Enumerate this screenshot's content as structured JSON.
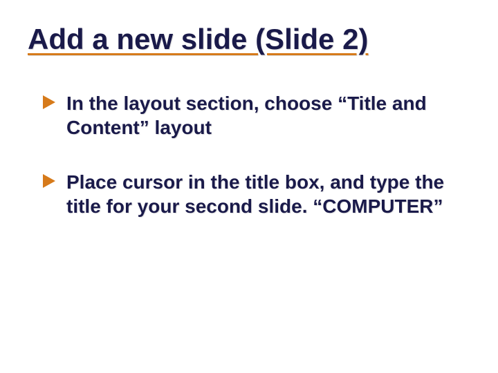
{
  "title": "Add a new slide (Slide 2)",
  "bullets": {
    "0": {
      "text": "In the layout section, choose “Title and Content” layout"
    },
    "1": {
      "text": "Place cursor in the title box, and type the title for your second slide. “COMPUTER”"
    }
  }
}
